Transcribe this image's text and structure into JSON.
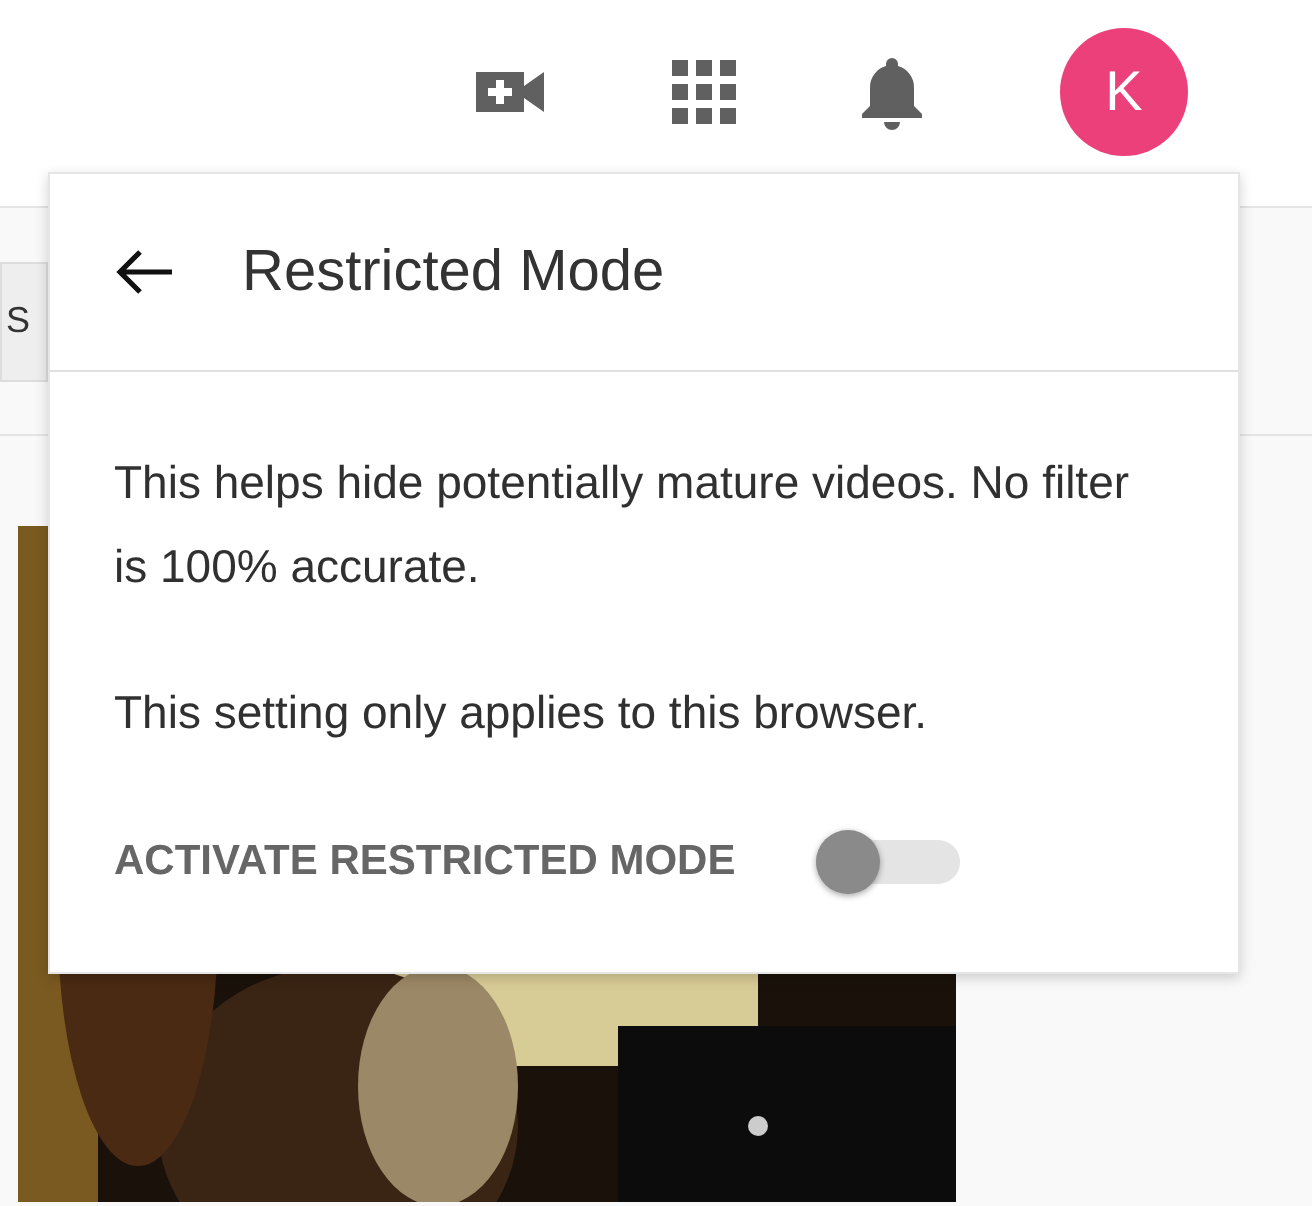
{
  "header": {
    "avatar": {
      "letter": "K",
      "color": "#ec407a"
    }
  },
  "chips": [
    {
      "label": "S"
    }
  ],
  "popup": {
    "title": "Restricted Mode",
    "paragraphs": [
      "This helps hide potentially mature videos. No filter is 100% accurate.",
      "This setting only applies to this browser."
    ],
    "toggle": {
      "label": "ACTIVATE RESTRICTED MODE",
      "on": false
    }
  }
}
